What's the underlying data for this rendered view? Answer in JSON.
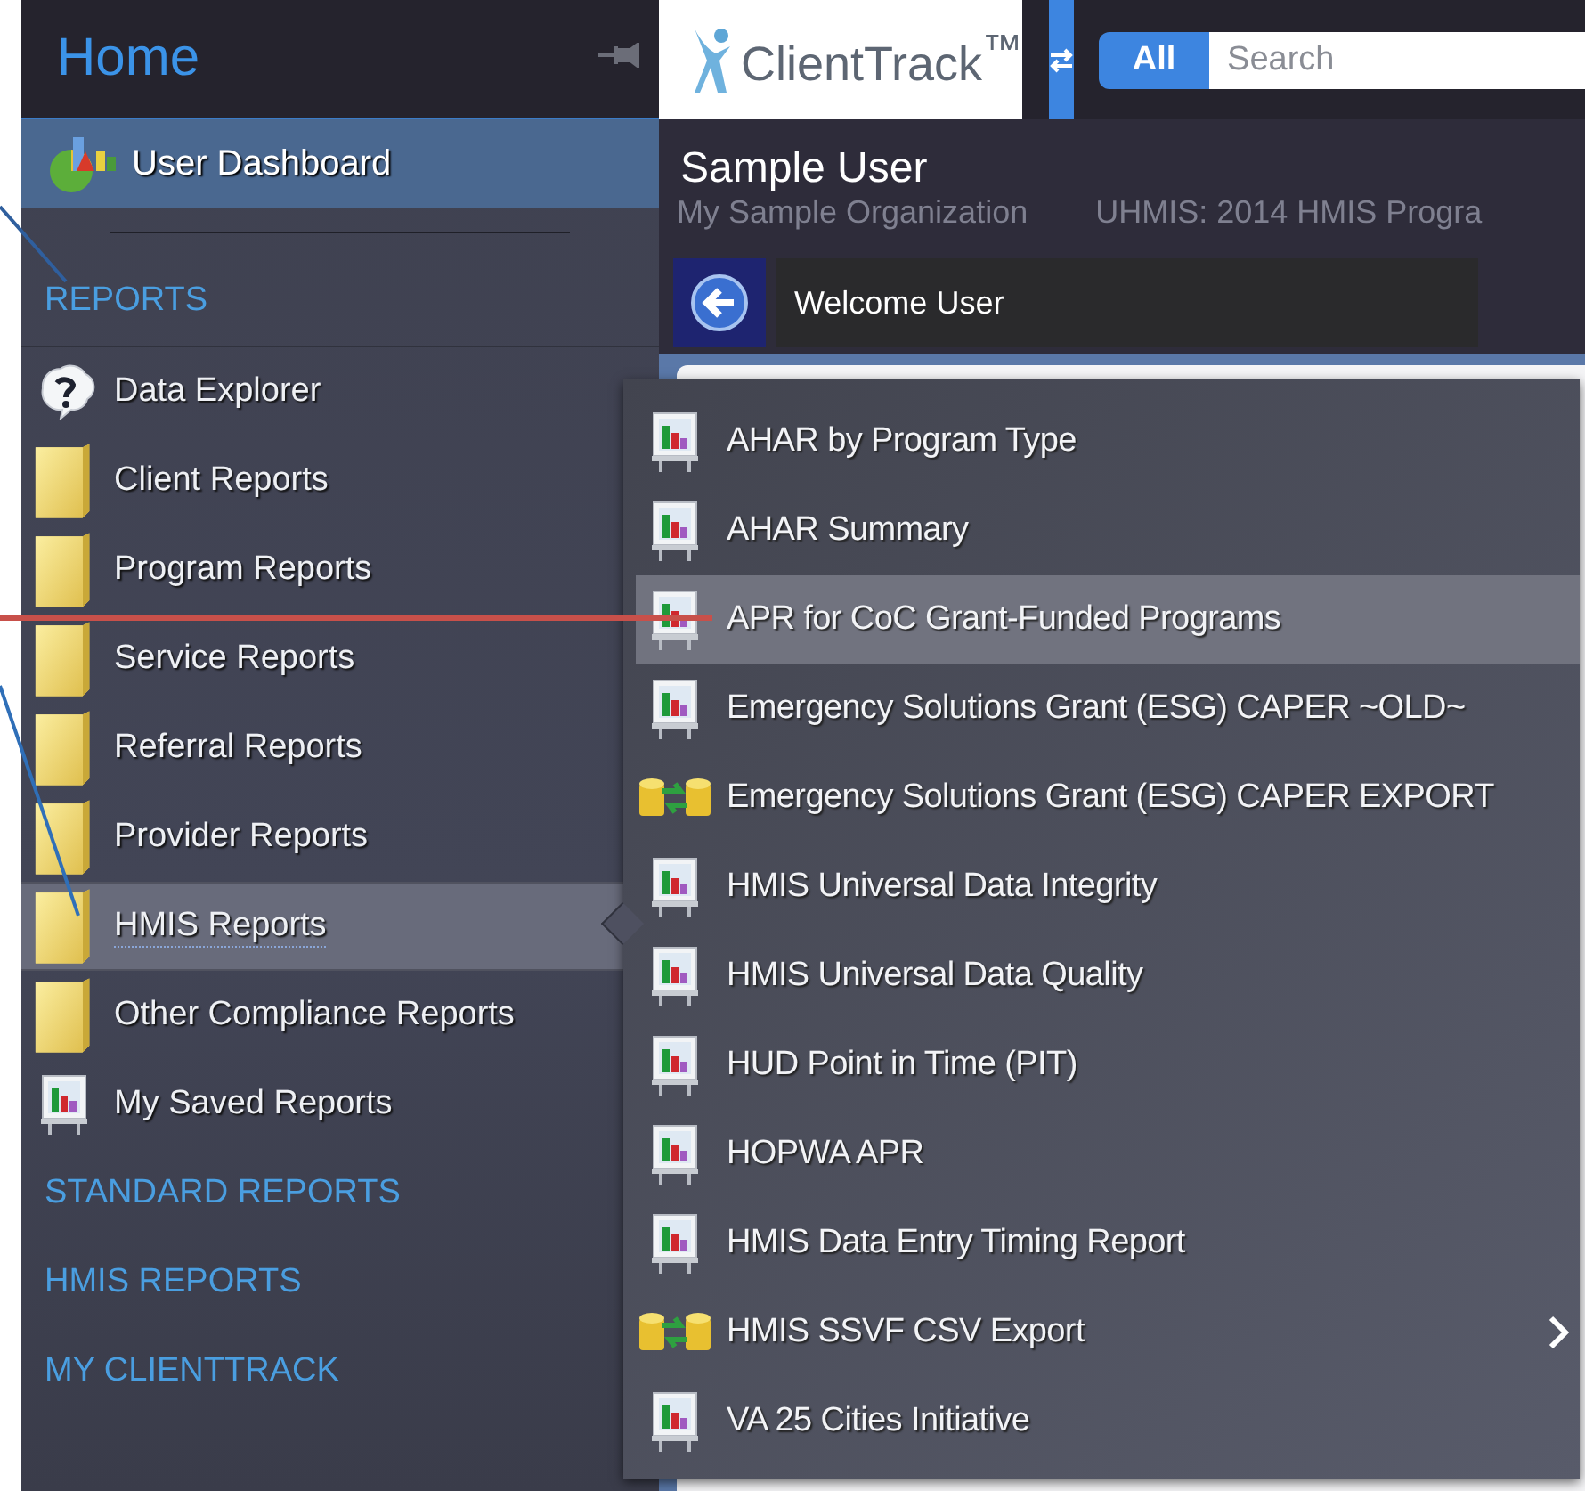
{
  "sidebar": {
    "title": "Home",
    "dashboard_link": "User Dashboard",
    "section": "REPORTS",
    "items": [
      {
        "label": "Data Explorer",
        "kind": "help",
        "selected": false
      },
      {
        "label": "Client Reports",
        "kind": "folder",
        "selected": false
      },
      {
        "label": "Program Reports",
        "kind": "folder",
        "selected": false
      },
      {
        "label": "Service Reports",
        "kind": "folder",
        "selected": false
      },
      {
        "label": "Referral Reports",
        "kind": "folder",
        "selected": false
      },
      {
        "label": "Provider Reports",
        "kind": "folder",
        "selected": false
      },
      {
        "label": "HMIS Reports",
        "kind": "folder",
        "selected": true
      },
      {
        "label": "Other Compliance Reports",
        "kind": "folder",
        "selected": false
      },
      {
        "label": "My Saved Reports",
        "kind": "report",
        "selected": false
      }
    ],
    "links": [
      "STANDARD REPORTS",
      "HMIS REPORTS",
      "MY CLIENTTRACK"
    ]
  },
  "header": {
    "logo": "ClientTrack$^{™}$",
    "scope_button": "All",
    "search": {
      "placeholder": "Search"
    }
  },
  "user": {
    "name": "Sample User",
    "organization": "My Sample Organization",
    "program": "UHMIS: 2014 HMIS Progra"
  },
  "welcome": "Welcome User",
  "submenu": {
    "items": [
      {
        "label": "AHAR by Program Type",
        "kind": "report",
        "selected": false,
        "has_submenu": false
      },
      {
        "label": "AHAR Summary",
        "kind": "report",
        "selected": false,
        "has_submenu": false
      },
      {
        "label": "APR for CoC Grant-Funded Programs",
        "kind": "report",
        "selected": true,
        "has_submenu": false
      },
      {
        "label": "Emergency Solutions Grant (ESG) CAPER ~OLD~",
        "kind": "report",
        "selected": false,
        "has_submenu": false
      },
      {
        "label": "Emergency Solutions Grant (ESG) CAPER EXPORT",
        "kind": "export",
        "selected": false,
        "has_submenu": false
      },
      {
        "label": "HMIS Universal Data Integrity",
        "kind": "report",
        "selected": false,
        "has_submenu": false
      },
      {
        "label": "HMIS Universal Data Quality",
        "kind": "report",
        "selected": false,
        "has_submenu": false
      },
      {
        "label": "HUD Point in Time (PIT)",
        "kind": "report",
        "selected": false,
        "has_submenu": false
      },
      {
        "label": "HOPWA APR",
        "kind": "report",
        "selected": false,
        "has_submenu": false
      },
      {
        "label": "HMIS Data Entry Timing Report",
        "kind": "report",
        "selected": false,
        "has_submenu": false
      },
      {
        "label": "HMIS SSVF CSV Export",
        "kind": "export",
        "selected": false,
        "has_submenu": true
      },
      {
        "label": "VA 25 Cities Initiative",
        "kind": "report",
        "selected": false,
        "has_submenu": false
      }
    ]
  }
}
